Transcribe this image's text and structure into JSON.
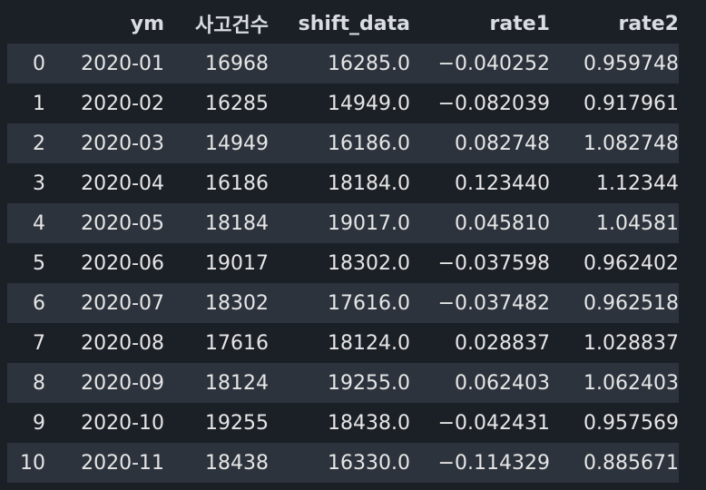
{
  "table": {
    "columns": [
      "",
      "ym",
      "사고건수",
      "shift_data",
      "rate1",
      "rate2"
    ],
    "rows": [
      [
        "0",
        "2020-01",
        "16968",
        "16285.0",
        "−0.040252",
        "0.959748"
      ],
      [
        "1",
        "2020-02",
        "16285",
        "14949.0",
        "−0.082039",
        "0.917961"
      ],
      [
        "2",
        "2020-03",
        "14949",
        "16186.0",
        "0.082748",
        "1.082748"
      ],
      [
        "3",
        "2020-04",
        "16186",
        "18184.0",
        "0.123440",
        "1.12344"
      ],
      [
        "4",
        "2020-05",
        "18184",
        "19017.0",
        "0.045810",
        "1.04581"
      ],
      [
        "5",
        "2020-06",
        "19017",
        "18302.0",
        "−0.037598",
        "0.962402"
      ],
      [
        "6",
        "2020-07",
        "18302",
        "17616.0",
        "−0.037482",
        "0.962518"
      ],
      [
        "7",
        "2020-08",
        "17616",
        "18124.0",
        "0.028837",
        "1.028837"
      ],
      [
        "8",
        "2020-09",
        "18124",
        "19255.0",
        "0.062403",
        "1.062403"
      ],
      [
        "9",
        "2020-10",
        "19255",
        "18438.0",
        "−0.042431",
        "0.957569"
      ],
      [
        "10",
        "2020-11",
        "18438",
        "16330.0",
        "−0.114329",
        "0.885671"
      ]
    ]
  }
}
